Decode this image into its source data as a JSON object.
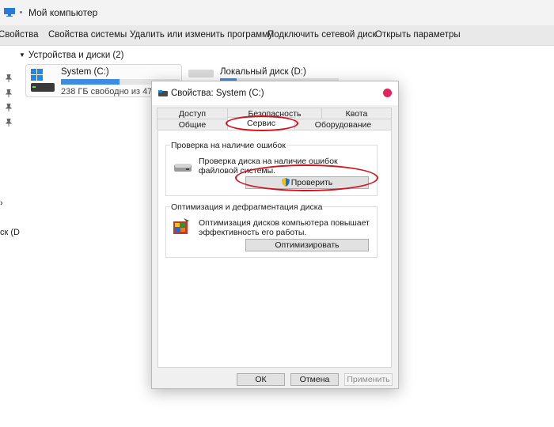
{
  "explorer": {
    "title": "Мой компьютер",
    "commands": [
      "Свойства",
      "Свойства системы",
      "Удалить или изменить программу",
      "Подключить сетевой диск",
      "Открыть параметры"
    ],
    "group_header": "Устройства и диски (2)",
    "left_fragment": "ск (D",
    "drives": [
      {
        "name": "System (C:)",
        "free_text": "238 ГБ свободно из 470 ГБ",
        "used_fraction": 0.49
      },
      {
        "name": "Локальный диск (D:)",
        "used_fraction": 0.14
      }
    ],
    "accent": "#3c8de0"
  },
  "dialog": {
    "title": "Свойства: System (C:)",
    "tabs_top": [
      "Доступ",
      "Безопасность",
      "Квота"
    ],
    "tabs_bottom": [
      "Общие",
      "Сервис",
      "Оборудование"
    ],
    "active_tab": "Сервис",
    "error_check": {
      "legend": "Проверка на наличие ошибок",
      "description": "Проверка диска на наличие ошибок файловой системы.",
      "button": "Проверить"
    },
    "optimize": {
      "legend": "Оптимизация и дефрагментация диска",
      "description": "Оптимизация дисков компьютера повышает эффективность его работы.",
      "button": "Оптимизировать"
    },
    "footer": {
      "ok": "ОК",
      "cancel": "Отмена",
      "apply": "Применить"
    },
    "highlight_color": "#d2121f"
  }
}
